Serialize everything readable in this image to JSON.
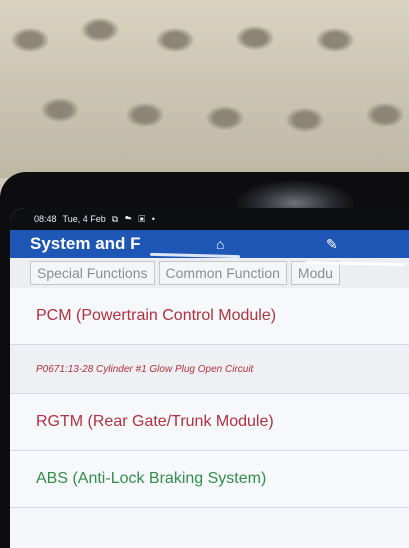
{
  "status_bar": {
    "time": "08:48",
    "date": "Tue, 4 Feb",
    "icons": [
      "vibrate-icon",
      "cloud-icon",
      "gallery-icon",
      "dot-icon"
    ]
  },
  "app_bar": {
    "title": "System and F",
    "home_icon": "home-icon",
    "report_icon": "edit-report-icon",
    "color": "#1e56b5"
  },
  "tabs": [
    {
      "label": "Special Functions"
    },
    {
      "label": "Common Function"
    },
    {
      "label": "Modu"
    }
  ],
  "list": [
    {
      "label": "PCM (Powertrain Control Module)",
      "color": "#b0313f"
    },
    {
      "label": "P0671:13-28 Cylinder #1 Glow Plug Open Circuit",
      "color": "#b0313f"
    },
    {
      "label": "RGTM (Rear Gate/Trunk Module)",
      "color": "#b0313f"
    },
    {
      "label": "ABS (Anti-Lock Braking System)",
      "color": "#2f8f4a"
    }
  ]
}
